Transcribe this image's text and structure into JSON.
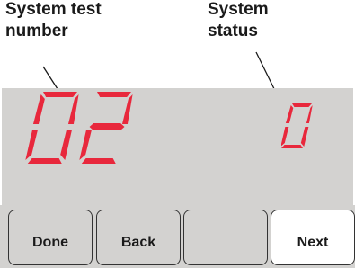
{
  "callouts": {
    "test_number_label_line1": "System test",
    "test_number_label_line2": "number",
    "status_label_line1": "System",
    "status_label_line2": "status"
  },
  "display": {
    "test_number": "02",
    "system_status": "0",
    "segment_color": "#e8283c",
    "screen_color": "#d3d2d0"
  },
  "buttons": {
    "done": "Done",
    "back": "Back",
    "blank": "",
    "next": "Next"
  }
}
